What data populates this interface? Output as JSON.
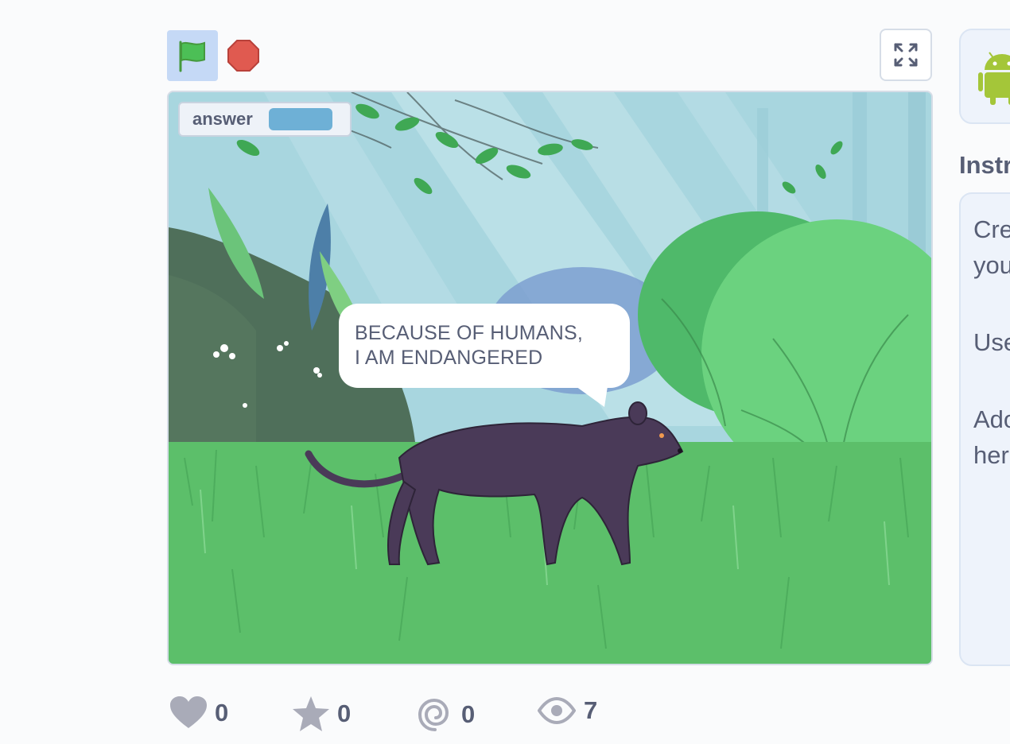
{
  "controls": {
    "green_flag_icon": "green-flag-icon",
    "stop_icon": "stop-sign-icon",
    "fullscreen_icon": "fullscreen-icon"
  },
  "stage": {
    "monitor": {
      "label": "answer",
      "value": ""
    },
    "speech_bubble": {
      "line1": "BECAUSE OF HUMANS,",
      "line2": "I AM ENDANGERED"
    }
  },
  "sidebar": {
    "card_icon": "android-icon",
    "instructions_title": "Instr",
    "instructions_lines": [
      "Cre",
      "you",
      "Use",
      "Ado",
      "her"
    ]
  },
  "stats": {
    "loves": "0",
    "favorites": "0",
    "remixes": "0",
    "views": "7"
  },
  "colors": {
    "accent_blue": "#c5d9f6",
    "stop_red": "#e05a50",
    "text_gray": "#575e75",
    "grass_green": "#5cbf6a",
    "panther_purple": "#4a3a58"
  }
}
